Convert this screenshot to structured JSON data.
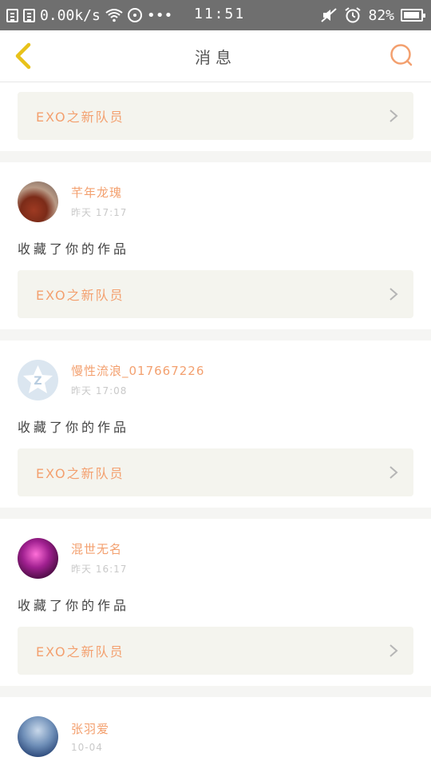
{
  "status_bar": {
    "speed": "0.00k/s",
    "dots": "•••",
    "time": "11:51",
    "battery": "82%"
  },
  "header": {
    "title": "消息"
  },
  "colors": {
    "accent": "#f3a06f",
    "back_arrow": "#e8c21a",
    "card_bg": "#f4f4ee"
  },
  "icons": {
    "back": "chevron-left-icon",
    "search": "search-icon",
    "chevron": "chevron-right-icon"
  },
  "feed": {
    "top_item": {
      "work_title": "EXO之新队员"
    },
    "items": [
      {
        "username": "芊年龙瑰",
        "time": "昨天 17:17",
        "action": "收藏了你的作品",
        "work_title": "EXO之新队员"
      },
      {
        "username": "慢性流浪_017667226",
        "time": "昨天 17:08",
        "action": "收藏了你的作品",
        "work_title": "EXO之新队员"
      },
      {
        "username": "混世无名",
        "time": "昨天 16:17",
        "action": "收藏了你的作品",
        "work_title": "EXO之新队员"
      },
      {
        "username": "张羽爱",
        "time": "10-04"
      }
    ]
  }
}
